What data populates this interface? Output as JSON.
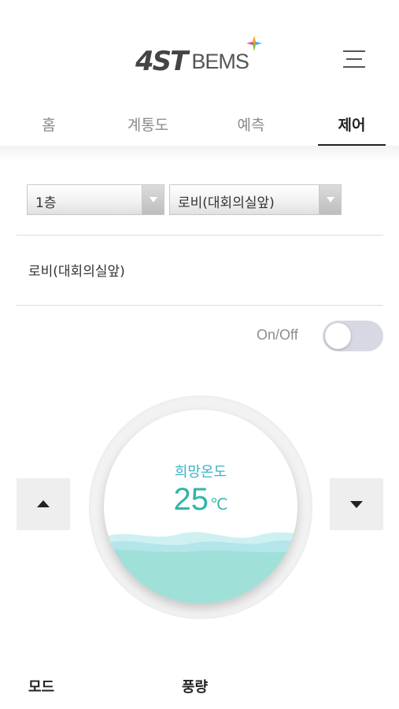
{
  "header": {
    "logo_mark": "4ST",
    "logo_text": "BEMS",
    "menu_icon": "hamburger-menu-icon"
  },
  "tabs": [
    {
      "label": "홈",
      "active": false
    },
    {
      "label": "계통도",
      "active": false
    },
    {
      "label": "예측",
      "active": false
    },
    {
      "label": "제어",
      "active": true
    }
  ],
  "filters": {
    "floor": {
      "selected": "1층"
    },
    "zone": {
      "selected": "로비(대회의실앞)"
    }
  },
  "location": {
    "title": "로비(대회의실앞)"
  },
  "power": {
    "label": "On/Off",
    "state": "off"
  },
  "thermostat": {
    "label": "희망온도",
    "value": "25",
    "unit": "℃",
    "colors": {
      "label": "#3bb3c8",
      "value": "#33b5a4",
      "wave_back": "#bfe9ea",
      "wave_mid": "#a7dfe6",
      "wave_front": "#9ee0d6"
    }
  },
  "controls": {
    "up_icon": "triangle-up-icon",
    "down_icon": "triangle-down-icon"
  },
  "sections": {
    "mode_label": "모드",
    "fan_label": "풍량"
  }
}
